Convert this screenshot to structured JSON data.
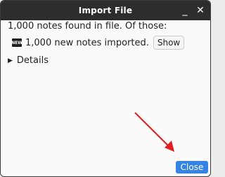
{
  "window": {
    "title": "Import File",
    "minimize_icon": "minimize-icon",
    "close_icon": "close-icon",
    "minimize_glyph": "_",
    "close_glyph": "✕"
  },
  "summary": {
    "found_text": "1,000 notes found in file. Of those:",
    "new_badge": "NEW",
    "new_notes_text": "1,000 new notes imported.",
    "show_label": "Show"
  },
  "details": {
    "label": "Details"
  },
  "footer": {
    "close_label": "Close"
  },
  "colors": {
    "titlebar": "#2d2d2d",
    "accent": "#3584e4",
    "annotation_arrow": "#e02020"
  }
}
